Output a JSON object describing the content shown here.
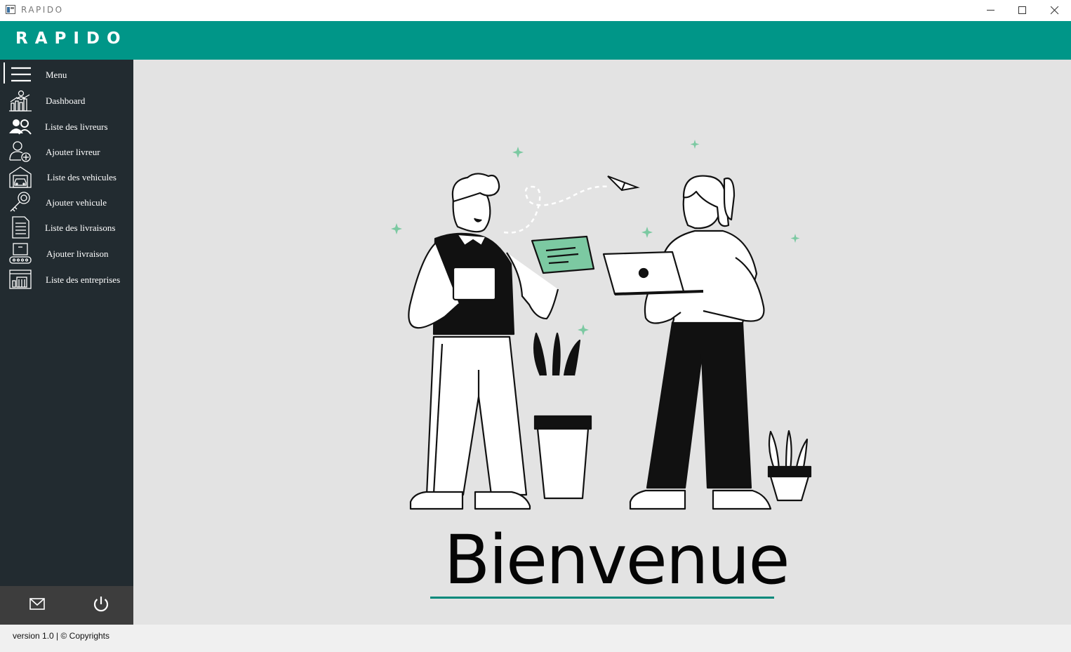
{
  "window": {
    "title": "RAPIDO"
  },
  "header": {
    "logo": "RAPIDO"
  },
  "sidebar": {
    "items": [
      {
        "label": "Menu",
        "icon": "hamburger-icon"
      },
      {
        "label": "Dashboard",
        "icon": "dashboard-chart-icon"
      },
      {
        "label": "Liste des livreurs",
        "icon": "users-icon"
      },
      {
        "label": "Ajouter livreur",
        "icon": "add-user-icon"
      },
      {
        "label": "Liste des vehicules",
        "icon": "garage-icon"
      },
      {
        "label": "Ajouter vehicule",
        "icon": "key-icon"
      },
      {
        "label": "Liste des livraisons",
        "icon": "document-list-icon"
      },
      {
        "label": "Ajouter livraison",
        "icon": "conveyor-box-icon"
      },
      {
        "label": "Liste des entreprises",
        "icon": "company-window-icon"
      }
    ],
    "bottom": {
      "mail_icon": "mail-icon",
      "power_icon": "power-icon"
    }
  },
  "main": {
    "welcome": "Bienvenue"
  },
  "footer": {
    "version": "version 1.0 | © Copyrights"
  },
  "colors": {
    "accent": "#009688",
    "sidebar": "#222b30",
    "sidebar_bottom": "#3d3d3d",
    "content_bg": "#e3e3e3",
    "mint": "#7cc9a2"
  }
}
